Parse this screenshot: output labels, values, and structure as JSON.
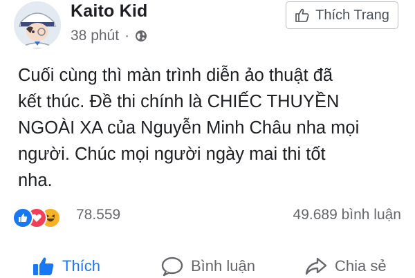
{
  "post": {
    "author": "Kaito Kid",
    "time": "38 phút",
    "separator": "·",
    "like_page_label": "Thích Trang",
    "text_lines": [
      "Cuối cùng thì màn trình diễn ảo thuật đã",
      "kết thúc. Đề thi chính là CHIẾC THUYỀN",
      "NGOÀI XA của Nguyễn Minh Châu nha mọi",
      "người. Chúc mọi người ngày mai thi tốt",
      "nha."
    ],
    "reaction_count": "78.559",
    "comment_count": "49.689 bình luận",
    "reactions": [
      "like-icon",
      "love-icon",
      "haha-icon"
    ]
  },
  "actions": {
    "like": "Thích",
    "comment": "Bình luận",
    "share": "Chia sẻ"
  },
  "colors": {
    "accent": "#1877f2",
    "love": "#f33e58",
    "haha": "#f7b125",
    "muted_text": "#65676b"
  }
}
